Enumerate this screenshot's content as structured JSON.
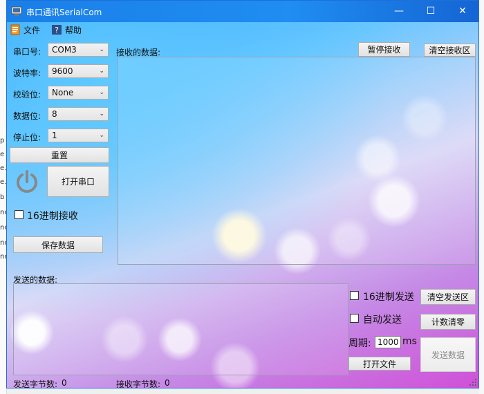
{
  "window": {
    "title": "串口通讯SerialCom",
    "minimize": "—",
    "maximize": "☐",
    "close": "✕"
  },
  "menu": {
    "file": "文件",
    "help": "帮助"
  },
  "settings": {
    "port_label": "串口号:",
    "port_value": "COM3",
    "baud_label": "波特率:",
    "baud_value": "9600",
    "parity_label": "校验位:",
    "parity_value": "None",
    "databits_label": "数据位:",
    "databits_value": "8",
    "stopbits_label": "停止位:",
    "stopbits_value": "1"
  },
  "buttons": {
    "reset": "重置",
    "open_port": "打开串口",
    "save_data": "保存数据",
    "pause_receive": "暂停接收",
    "clear_receive": "清空接收区",
    "clear_send": "清空发送区",
    "clear_count": "计数清零",
    "open_file": "打开文件",
    "send_data": "发送数据"
  },
  "receive": {
    "label": "接收的数据:",
    "hex_receive": "16进制接收"
  },
  "send": {
    "label": "发送的数据:",
    "hex_send": "16进制发送",
    "auto_send": "自动发送",
    "period_label": "周期:",
    "period_value": "1000",
    "period_unit": "ms"
  },
  "status": {
    "sent_bytes_label": "发送字节数:",
    "sent_bytes": "0",
    "recv_bytes_label": "接收字节数:",
    "recv_bytes": "0"
  },
  "colors": {
    "titlebar": "#1f8df2",
    "power_icon": "#888888"
  },
  "icons": {
    "app": "serial-app-icon",
    "file": "file-menu-icon",
    "help": "help-menu-icon",
    "power": "power-icon",
    "combo_arrow": "chevron-down-icon"
  }
}
